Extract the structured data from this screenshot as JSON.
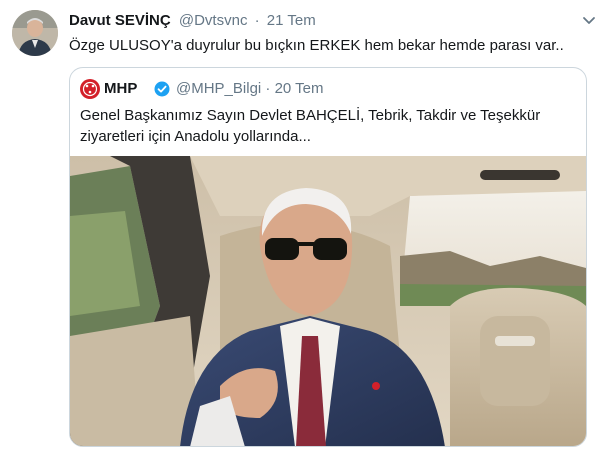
{
  "tweet": {
    "author_name": "Davut SEVİNÇ",
    "author_handle": "@Dvtsvnc",
    "dot": "·",
    "time": "21 Tem",
    "text": "Özge ULUSOY'a duyrulur bu bıçkın ERKEK hem bekar hemde parası var..",
    "caret_icon": "chevron-down-icon"
  },
  "quote": {
    "author_name": "MHP",
    "verified_icon": "verified-badge-icon",
    "author_handle": "@MHP_Bilgi",
    "dot": "·",
    "time": "20 Tem",
    "text_line1": "Genel Başkanımız Sayın Devlet BAHÇELİ, Tebrik, Takdir ve Teşekkür",
    "text_line2": "ziyaretleri için Anadolu yollarında..."
  },
  "colors": {
    "text_primary": "#14171a",
    "text_secondary": "#657786",
    "border": "#ccd6dd",
    "verified_blue": "#1da1f2",
    "mhp_red": "#d3202a"
  }
}
